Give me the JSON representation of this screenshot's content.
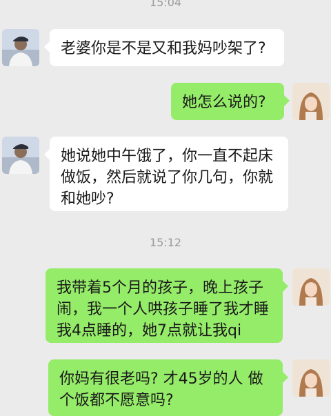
{
  "chat": {
    "timestamps": [
      "15:04",
      "15:12"
    ],
    "messages": [
      {
        "side": "left",
        "sender_avatar": "husband-avatar",
        "text": "老婆你是不是又和我妈吵架了?"
      },
      {
        "side": "right",
        "sender_avatar": "wife-avatar",
        "text": "她怎么说的?"
      },
      {
        "side": "left",
        "sender_avatar": "husband-avatar",
        "text": "她说她中午饿了，你一直不起床做饭，然后就说了你几句，你就和她吵?"
      },
      {
        "side": "right",
        "sender_avatar": "wife-avatar",
        "text": "我带着5个月的孩子，晚上孩子闹，我一个人哄孩子睡了我才睡我4点睡的，她7点就让我qi"
      },
      {
        "side": "right",
        "sender_avatar": "wife-avatar",
        "text": "你妈有很老吗? 才45岁的人 做个饭都不愿意吗?"
      }
    ]
  },
  "colors": {
    "background": "#ebebeb",
    "bubble_received": "#ffffff",
    "bubble_sent": "#95ec69",
    "timestamp_text": "#9a9a9a"
  }
}
